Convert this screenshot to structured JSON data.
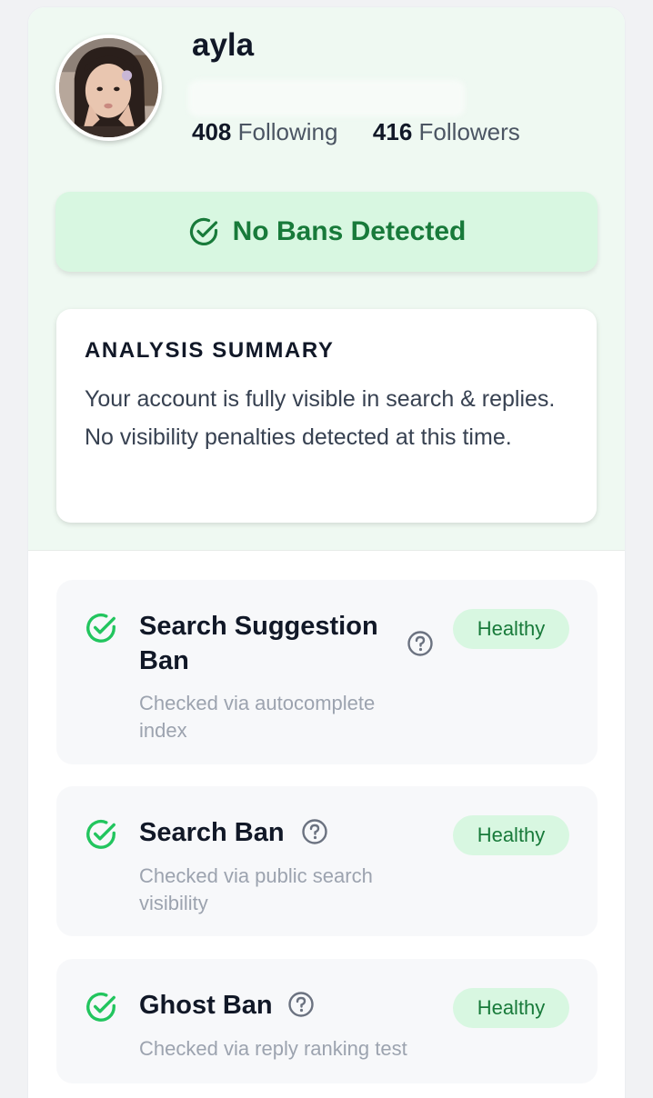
{
  "profile": {
    "username": "ayla",
    "following_count": "408",
    "following_label": "Following",
    "followers_count": "416",
    "followers_label": "Followers"
  },
  "status": {
    "text": "No Bans Detected",
    "icon": "check-circle-icon",
    "color": "#187a3a",
    "background": "#d8f7e1"
  },
  "summary": {
    "heading": "ANALYSIS SUMMARY",
    "body": "Your account is fully visible in search & replies. No visibility penalties detected at this time."
  },
  "checks": [
    {
      "title_line1": "Search Suggestion",
      "title_line2": "Ban",
      "sub_line1": "Checked via autocomplete",
      "sub_line2": "index",
      "status": "Healthy",
      "icon": "check-circle-icon"
    },
    {
      "title": "Search Ban",
      "sub_line1": "Checked via public search",
      "sub_line2": "visibility",
      "status": "Healthy",
      "icon": "check-circle-icon"
    },
    {
      "title": "Ghost Ban",
      "sub_line1": "Checked via reply ranking test",
      "status": "Healthy",
      "icon": "check-circle-icon"
    }
  ],
  "colors": {
    "accent_green": "#22c55e",
    "healthy_text": "#187a3a",
    "healthy_bg": "#d8f7e1"
  }
}
